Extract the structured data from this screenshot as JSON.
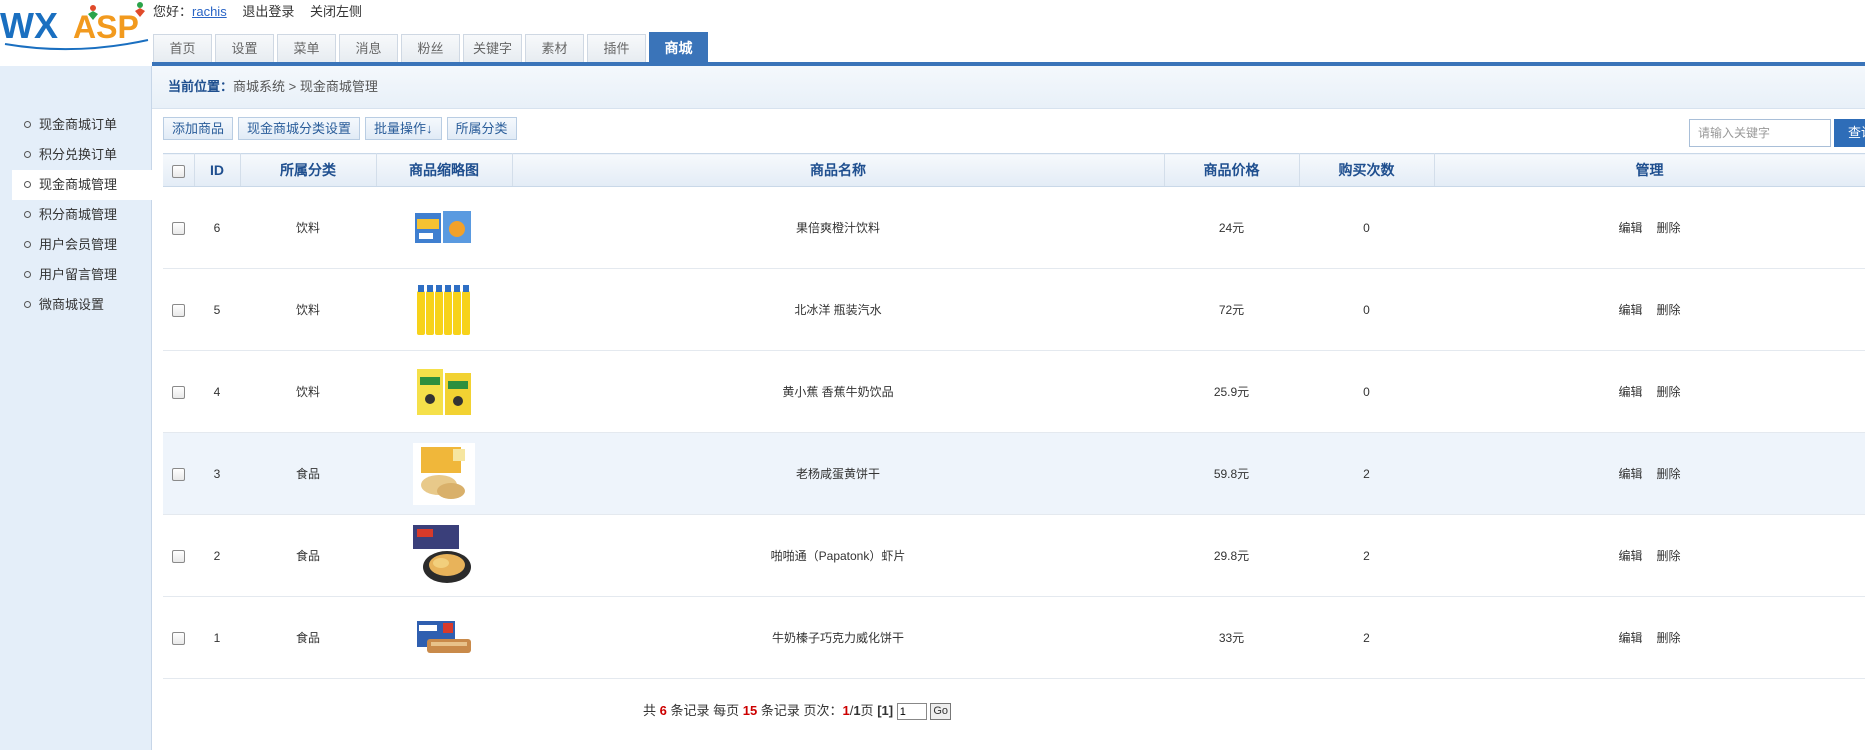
{
  "brand": {
    "logo_text_1": "WX",
    "logo_text_2": "ASP"
  },
  "userbar": {
    "greeting": "您好：",
    "username": "rachis",
    "logout": "退出登录",
    "close_left": "关闭左侧"
  },
  "tabs": [
    "首页",
    "设置",
    "菜单",
    "消息",
    "粉丝",
    "关键字",
    "素材",
    "插件",
    "商城"
  ],
  "active_tab_index": 8,
  "sidebar": {
    "items": [
      "现金商城订单",
      "积分兑换订单",
      "现金商城管理",
      "积分商城管理",
      "用户会员管理",
      "用户留言管理",
      "微商城设置"
    ],
    "active_index": 2
  },
  "breadcrumb": {
    "label": "当前位置：",
    "path": "商城系统 > 现金商城管理"
  },
  "toolbar": {
    "add": "添加商品",
    "category_settings": "现金商城分类设置",
    "batch": "批量操作↓",
    "category": "所属分类"
  },
  "search": {
    "placeholder": "请输入关键字",
    "button": "查询"
  },
  "table": {
    "headers": [
      "ID",
      "所属分类",
      "商品缩略图",
      "商品名称",
      "商品价格",
      "购买次数",
      "管理"
    ],
    "edit_label": "编辑",
    "delete_label": "删除",
    "rows": [
      {
        "id": "6",
        "category": "饮料",
        "name": "果倍爽橙汁饮料",
        "price": "24元",
        "count": "0",
        "thumb": "juice-box-thumbnail"
      },
      {
        "id": "5",
        "category": "饮料",
        "name": "北冰洋 瓶装汽水",
        "price": "72元",
        "count": "0",
        "thumb": "soda-bottles-thumbnail"
      },
      {
        "id": "4",
        "category": "饮料",
        "name": "黄小蕉 香蕉牛奶饮品",
        "price": "25.9元",
        "count": "0",
        "thumb": "banana-milk-thumbnail"
      },
      {
        "id": "3",
        "category": "食品",
        "name": "老杨咸蛋黄饼干",
        "price": "59.8元",
        "count": "2",
        "thumb": "egg-biscuit-thumbnail"
      },
      {
        "id": "2",
        "category": "食品",
        "name": "啪啪通（Papatonk）虾片",
        "price": "29.8元",
        "count": "2",
        "thumb": "shrimp-chips-thumbnail"
      },
      {
        "id": "1",
        "category": "食品",
        "name": "牛奶榛子巧克力威化饼干",
        "price": "33元",
        "count": "2",
        "thumb": "wafer-thumbnail"
      }
    ],
    "highlight_row_index": 3
  },
  "pager": {
    "t1": "共",
    "total": "6",
    "t2": "条记录 每页",
    "per_page": "15",
    "t3": "条记录 页次：",
    "current": "1",
    "sep": "/",
    "pages": "1",
    "t4": "页",
    "bracket": "[1]",
    "input_value": "1",
    "go": "Go"
  }
}
